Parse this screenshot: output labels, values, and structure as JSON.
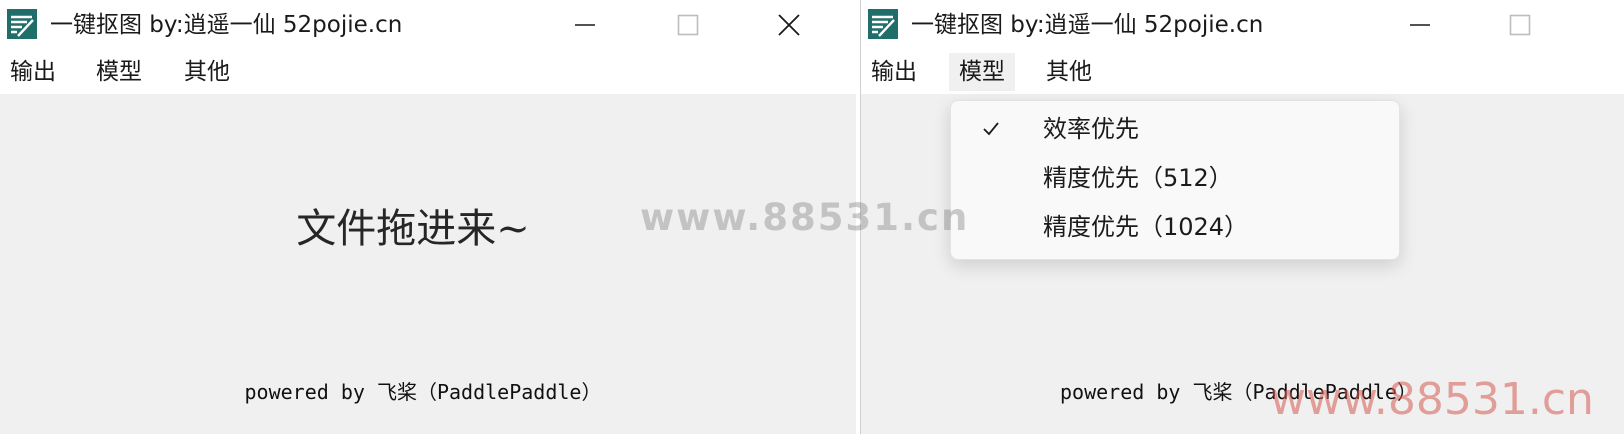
{
  "windows": [
    {
      "title": "一键抠图  by:逍遥一仙 52pojie.cn",
      "menu": [
        "输出",
        "模型",
        "其他"
      ],
      "drop_hint": "文件拖进来~",
      "powered_by": "powered by 飞桨（PaddlePaddle）",
      "controls": [
        "minimize-icon",
        "maximize-icon",
        "close-icon"
      ]
    },
    {
      "title": "一键抠图  by:逍遥一仙 52pojie.cn",
      "menu": [
        "输出",
        "模型",
        "其他"
      ],
      "powered_by": "powered by 飞桨（PaddlePaddle）",
      "controls": [
        "minimize-icon",
        "maximize-icon"
      ],
      "model_menu": {
        "open": true,
        "items": [
          {
            "label": "效率优先",
            "checked": true
          },
          {
            "label": "精度优先（512）",
            "checked": false
          },
          {
            "label": "精度优先（1024）",
            "checked": false
          }
        ]
      }
    }
  ],
  "watermarks": {
    "center": "www.88531.cn",
    "corner": "www.88531.cn"
  },
  "colors": {
    "window_bg": "#f0f0f0",
    "titlebar_bg": "#ffffff",
    "dropdown_bg": "#f9f9f9",
    "icon_teal": "#1f6e6a",
    "watermark_center": "#787878",
    "watermark_corner": "#d65a50"
  }
}
